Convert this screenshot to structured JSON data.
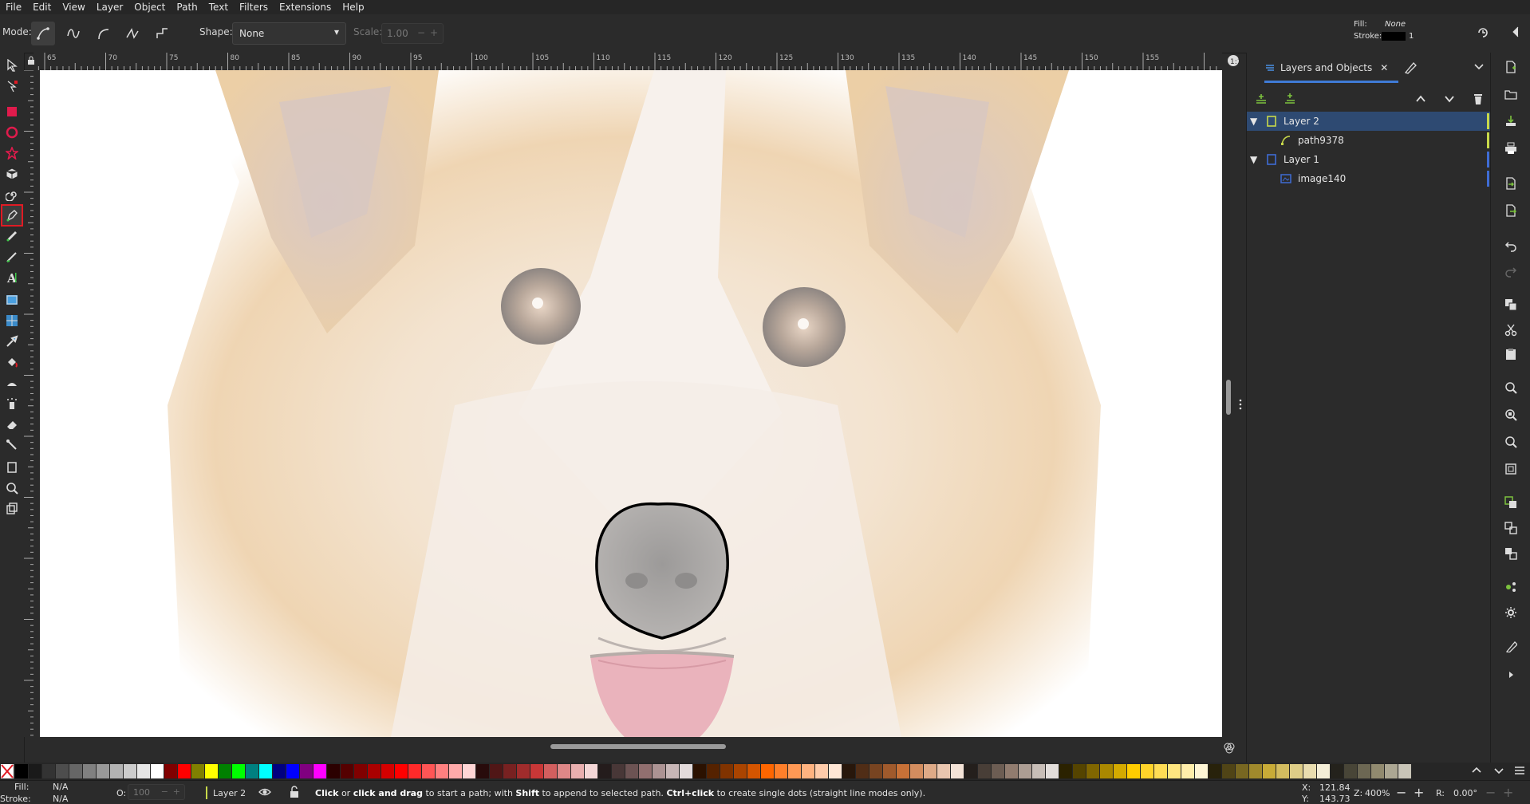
{
  "menu": [
    "File",
    "Edit",
    "View",
    "Layer",
    "Object",
    "Path",
    "Text",
    "Filters",
    "Extensions",
    "Help"
  ],
  "toolctl": {
    "mode_label": "Mode:",
    "shape_label": "Shape:",
    "shape_value": "None",
    "scale_label": "Scale:",
    "scale_value": "1.00"
  },
  "style_indicator": {
    "fill_label": "Fill:",
    "fill_value": "None",
    "stroke_label": "Stroke:",
    "stroke_width": "1"
  },
  "ruler_h": [
    "65",
    "70",
    "75",
    "80",
    "85",
    "90",
    "95",
    "100",
    "105",
    "110",
    "115",
    "120",
    "125",
    "130",
    "135",
    "140",
    "145",
    "150",
    "155"
  ],
  "panel": {
    "tab_label": "Layers and Objects",
    "items": [
      {
        "label": "Layer 2",
        "kind": "layer",
        "indent": 0,
        "selected": true,
        "color": "#c8d94a"
      },
      {
        "label": "path9378",
        "kind": "path",
        "indent": 1,
        "selected": false,
        "color": "#c8d94a"
      },
      {
        "label": "Layer 1",
        "kind": "layer",
        "indent": 0,
        "selected": false,
        "color": "#3f6cd4"
      },
      {
        "label": "image140",
        "kind": "image",
        "indent": 1,
        "selected": false,
        "color": "#3f6cd4"
      }
    ]
  },
  "status": {
    "fill_label": "Fill:",
    "fill_value": "N/A",
    "stroke_label": "Stroke:",
    "stroke_value": "N/A",
    "opacity_label": "O:",
    "opacity_value": "100",
    "layer_name": "Layer 2",
    "hint_bold1": "Click",
    "hint_t1": " or ",
    "hint_bold2": "click and drag",
    "hint_t2": " to start a path; with ",
    "hint_bold3": "Shift",
    "hint_t3": " to append to selected path. ",
    "hint_bold4": "Ctrl+click",
    "hint_t4": " to create single dots (straight line modes only).",
    "x_label": "X:",
    "x_value": "121.84",
    "y_label": "Y:",
    "y_value": "143.73",
    "zoom_label": "Z:",
    "zoom_value": "400%",
    "rotate_label": "R:",
    "rotate_value": "0.00°"
  },
  "palette": [
    "#000000",
    "#1a1a1a",
    "#333333",
    "#4d4d4d",
    "#666666",
    "#808080",
    "#999999",
    "#b3b3b3",
    "#cccccc",
    "#e6e6e6",
    "#ffffff",
    "#800000",
    "#ff0000",
    "#808000",
    "#ffff00",
    "#008000",
    "#00ff00",
    "#008080",
    "#00ffff",
    "#000080",
    "#0000ff",
    "#800080",
    "#ff00ff",
    "#2b0000",
    "#550000",
    "#800000",
    "#aa0000",
    "#d40000",
    "#ff0000",
    "#ff2a2a",
    "#ff5555",
    "#ff8080",
    "#ffaaaa",
    "#ffd5d5",
    "#280b0b",
    "#501616",
    "#782121",
    "#a02c2c",
    "#c83737",
    "#d35f5f",
    "#de8787",
    "#e9afaf",
    "#f4d7d7",
    "#241c1c",
    "#483737",
    "#6c5353",
    "#916f6f",
    "#ac9393",
    "#c8b7b7",
    "#e3dbdb",
    "#2b1100",
    "#552200",
    "#803300",
    "#aa4400",
    "#d45500",
    "#ff6600",
    "#ff7f2a",
    "#ff9955",
    "#ffb380",
    "#ffccaa",
    "#ffe6d5",
    "#28170b",
    "#502d16",
    "#784421",
    "#a05a2c",
    "#c87137",
    "#d38d5f",
    "#deaa87",
    "#e9c6af",
    "#f4e3d7",
    "#241f1c",
    "#483e37",
    "#6c5d53",
    "#917c6f",
    "#ac9d93",
    "#c8beb7",
    "#e3dedb",
    "#2b2200",
    "#554400",
    "#806600",
    "#aa8800",
    "#d4aa00",
    "#ffcc00",
    "#ffd42a",
    "#ffdd55",
    "#ffe680",
    "#ffeeaa",
    "#fff6d5",
    "#28220b",
    "#504416",
    "#786721",
    "#a0892c",
    "#c8ab37",
    "#d3bc5f",
    "#decd87",
    "#e9ddaf",
    "#f4eed7",
    "#24221c",
    "#484537",
    "#6c6753",
    "#918a6f",
    "#aca793",
    "#c8c4b7"
  ]
}
